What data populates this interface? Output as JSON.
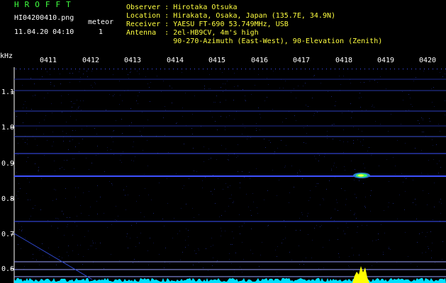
{
  "header": {
    "brand": "HROFFT",
    "filename": "HI04200410.png",
    "datetime": "11.04.20 04:10",
    "meteor_label": "meteor",
    "meteor_count": "1",
    "info_lines": [
      "Observer : Hirotaka Otsuka",
      "Location : Hirakata, Osaka, Japan (135.7E, 34.9N)",
      "Receiver : YAESU FT-690 53.749MHz, USB",
      "Antenna  : 2el-HB9CV, 4m's high",
      "           90-270-Azimuth (East-West), 90-Elevation (Zenith)"
    ]
  },
  "axis": {
    "y_unit": "kHz",
    "y_ticks": [
      "1.1",
      "1.0",
      "0.9",
      "0.8",
      "0.7",
      "0.6"
    ],
    "x_ticks": [
      "0411",
      "0412",
      "0413",
      "0414",
      "0415",
      "0416",
      "0417",
      "0418",
      "0419",
      "0420"
    ]
  },
  "colors": {
    "background": "#000000",
    "label_green": "#3fff3f",
    "header_yellow": "#ffff40",
    "signal_blue": "#3c50ff",
    "noise_cyan": "#00e0ff",
    "burst_yellow": "#ffff00"
  }
}
